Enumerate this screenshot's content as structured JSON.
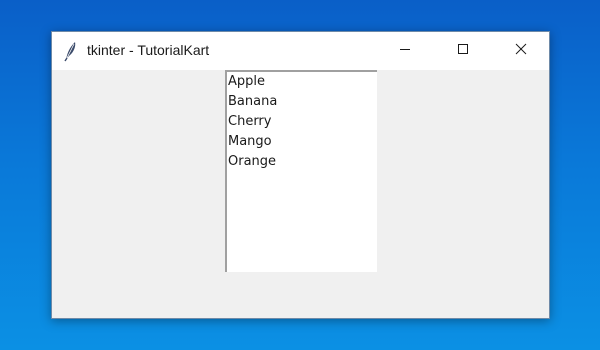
{
  "window": {
    "title": "tkinter - TutorialKart",
    "controls": {
      "minimize_icon": "minimize-icon",
      "maximize_icon": "maximize-icon",
      "close_icon": "close-icon"
    },
    "app_icon": "feather-icon"
  },
  "listbox": {
    "items": [
      {
        "label": "Apple"
      },
      {
        "label": "Banana"
      },
      {
        "label": "Cherry"
      },
      {
        "label": "Mango"
      },
      {
        "label": "Orange"
      }
    ]
  },
  "colors": {
    "desktop_top": "#0a5fc8",
    "desktop_bottom": "#0b90e4",
    "window_background": "#f0f0f0",
    "titlebar_background": "#ffffff",
    "listbox_background": "#ffffff"
  }
}
